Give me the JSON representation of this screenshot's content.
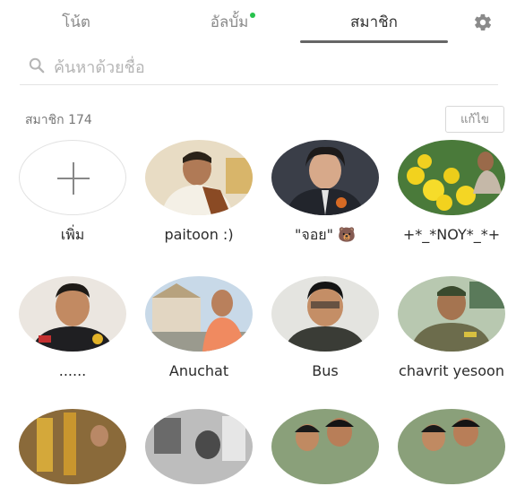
{
  "tabs": [
    {
      "label": "โน้ต",
      "active": false
    },
    {
      "label": "อัลบั้ม",
      "active": false,
      "has_dot": true
    },
    {
      "label": "สมาชิก",
      "active": true
    }
  ],
  "search": {
    "placeholder": "ค้นหาด้วยชื่อ"
  },
  "members_header": {
    "count_label": "สมาชิก 174",
    "edit_label": "แก้ไข"
  },
  "members": [
    {
      "name": "เพิ่ม"
    },
    {
      "name": "paitoon :)"
    },
    {
      "name": "\"จอย\" 🐻"
    },
    {
      "name": "+*_*NOY*_*+"
    },
    {
      "name": "......"
    },
    {
      "name": "Anuchat"
    },
    {
      "name": "Bus"
    },
    {
      "name": "chavrit yesoon"
    },
    {
      "name": ""
    },
    {
      "name": ""
    },
    {
      "name": ""
    },
    {
      "name": ""
    }
  ],
  "colors": {
    "accent_dot": "#27c24c",
    "active_tab_underline": "#666666"
  }
}
